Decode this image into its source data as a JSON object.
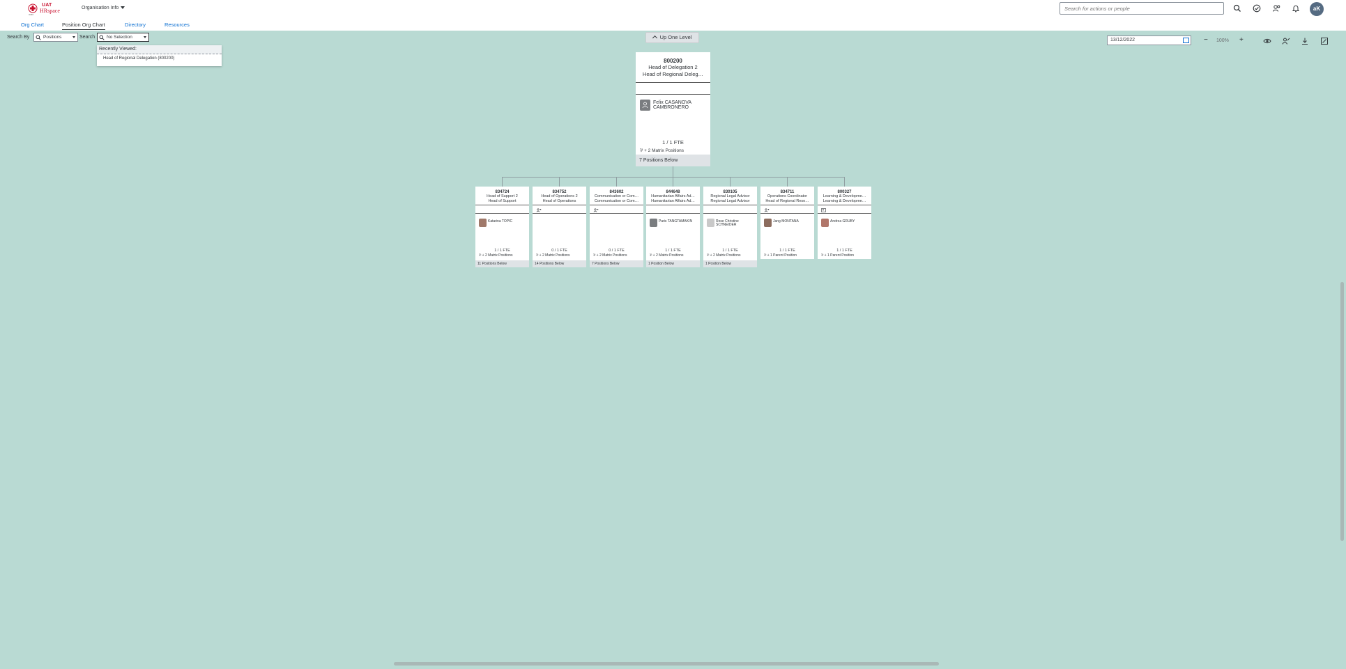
{
  "header": {
    "logo": {
      "uat": "UAT",
      "hr": "HRspace",
      "org": "ICRC"
    },
    "app_menu": "Organisation Info",
    "search_placeholder": "Search for actions or people",
    "avatar_initials": "aK"
  },
  "tabs": [
    {
      "label": "Org Chart"
    },
    {
      "label": "Position Org Chart",
      "active": true
    },
    {
      "label": "Directory"
    },
    {
      "label": "Resources"
    }
  ],
  "toolbar": {
    "search_by_label": "Search By",
    "search_by_value": "Positions",
    "search_label": "Search",
    "search_value": "No Selection",
    "recently_viewed_title": "Recently Viewed:",
    "recently_viewed_items": [
      "Head of Regional Delegation (800200)"
    ],
    "up_one_level": "Up One Level",
    "date": "13/12/2022",
    "zoom_minus": "−",
    "zoom_level": "100%",
    "zoom_plus": "+"
  },
  "root": {
    "code": "800200",
    "title1": "Head of Delegation 2",
    "title2": "Head of Regional Deleg…",
    "person": "Felix CASANOVA CAMBRONERO",
    "fte": "1 / 1 FTE",
    "matrix": "+ 2 Matrix Positions",
    "below": "7 Positions Below"
  },
  "children": [
    {
      "code": "834724",
      "title1": "Head of Support 2",
      "title2": "Head of Support",
      "person": "Katarina TOPIC",
      "fte": "1 / 1 FTE",
      "matrix": "+ 2 Matrix Positions",
      "below": "11 Positions Below"
    },
    {
      "code": "834752",
      "title1": "Head of Operations 2",
      "title2": "Head of Operations",
      "person": "",
      "fte": "0 / 1 FTE",
      "matrix": "+ 2 Matrix Positions",
      "below": "14 Positions Below"
    },
    {
      "code": "843602",
      "title1": "Communication or Com…",
      "title2": "Communication or Com…",
      "person": "",
      "fte": "0 / 1 FTE",
      "matrix": "+ 2 Matrix Positions",
      "below": "7 Positions Below"
    },
    {
      "code": "844648",
      "title1": "Humanitarian Affairs Ad…",
      "title2": "Humanitarian Affairs Ad…",
      "person": "Paris TANGTAMAKIN",
      "fte": "1 / 1 FTE",
      "matrix": "+ 2 Matrix Positions",
      "below": "1 Position Below"
    },
    {
      "code": "830105",
      "title1": "Regional Legal Advisor",
      "title2": "Regional Legal Advisor",
      "person": "Rose Christine SCHNEIDER",
      "fte": "1 / 1 FTE",
      "matrix": "+ 2 Matrix Positions",
      "below": "1 Position Below"
    },
    {
      "code": "834711",
      "title1": "Operations Coordinator",
      "title2": "Head of Regional Reso…",
      "person": "Jang MONTANA",
      "fte": "1 / 1 FTE",
      "matrix": "+ 1 Parent Position",
      "below": ""
    },
    {
      "code": "800327",
      "title1": "Learning & Developme…",
      "title2": "Learning & Developme…",
      "person": "Andrea GRUBY",
      "fte": "1 / 1 FTE",
      "matrix": "+ 1 Parent Position",
      "below": ""
    }
  ],
  "colors": {
    "background": "#b9dad3",
    "link": "#0a6ed1",
    "avatar": "#556b82"
  }
}
